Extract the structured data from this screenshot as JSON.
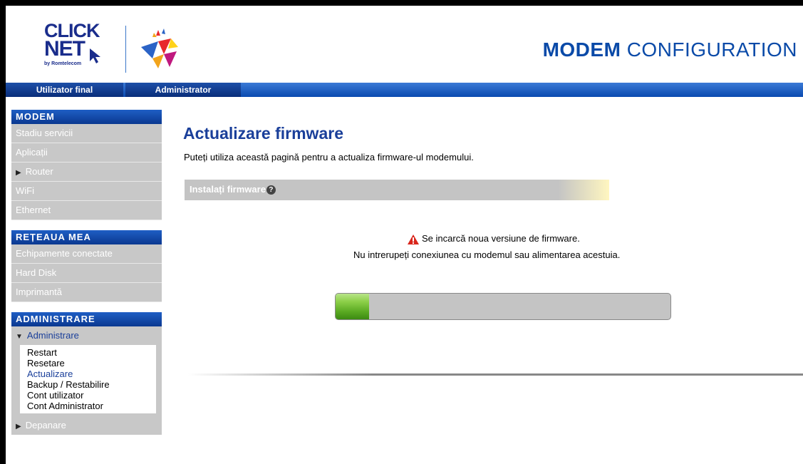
{
  "header": {
    "logo_line1": "CLICK",
    "logo_line2": "NET",
    "logo_line3": "by Romtelecom",
    "title_bold": "MODEM",
    "title_rest": "CONFIGURATION"
  },
  "tabs": [
    {
      "label": "Utilizator final"
    },
    {
      "label": "Administrator"
    }
  ],
  "sidebar": {
    "sections": [
      {
        "title": "MODEM",
        "items": [
          "Stadiu servicii",
          "Aplicații",
          "Router",
          "WiFi",
          "Ethernet"
        ]
      },
      {
        "title": "REȚEAUA MEA",
        "items": [
          "Echipamente conectate",
          "Hard Disk",
          "Imprimantă"
        ]
      },
      {
        "title": "ADMINISTRARE",
        "expanded": "Administrare",
        "subitems": [
          "Restart",
          "Resetare",
          "Actualizare",
          "Backup / Restabilire",
          "Cont utilizator",
          "Cont Administrator"
        ],
        "last_item": "Depanare"
      }
    ]
  },
  "main": {
    "title": "Actualizare firmware",
    "description": "Puteți utiliza această pagină pentru a actualiza firmware-ul modemului.",
    "install_label": "Instalați firmware",
    "warning_line1": "Se incarcă noua versiune de firmware.",
    "warning_line2": "Nu intrerupeți conexiunea cu modemul sau alimentarea acestuia.",
    "progress_fraction": 0.1
  },
  "colors": {
    "brand_blue": "#1a3f9a",
    "section_blue": "#0a3890",
    "progress_green": "#5aaa22",
    "warning_red": "#d9261c"
  }
}
